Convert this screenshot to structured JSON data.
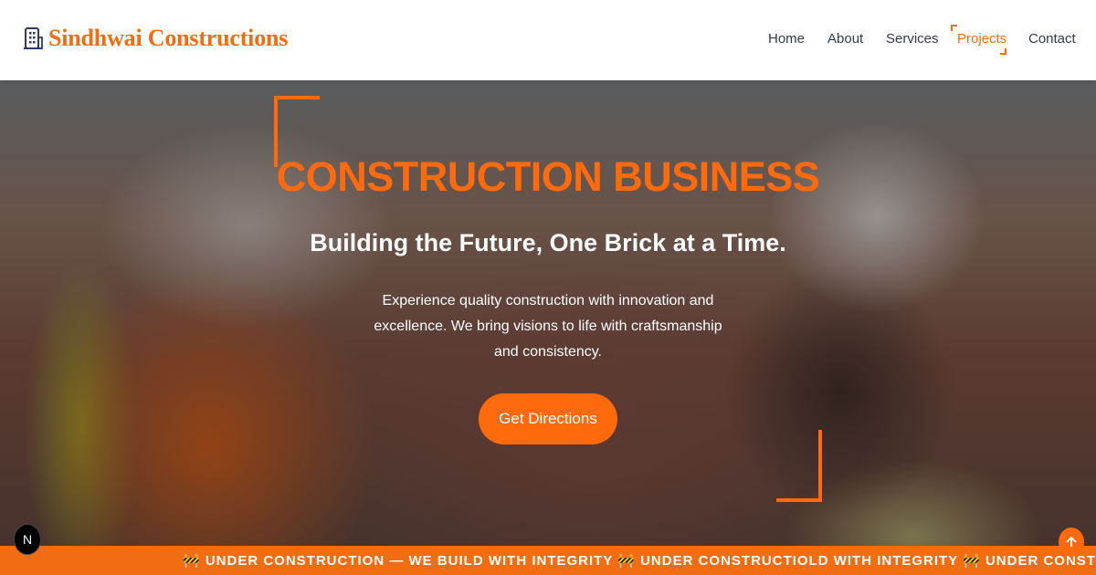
{
  "brand": {
    "name": "Sindhwai Constructions",
    "icon": "building-icon",
    "color": "#f26d12"
  },
  "nav": {
    "items": [
      {
        "label": "Home"
      },
      {
        "label": "About"
      },
      {
        "label": "Services"
      },
      {
        "label": "Projects",
        "active": true
      },
      {
        "label": "Contact"
      }
    ]
  },
  "hero": {
    "title": "CONSTRUCTION BUSINESS",
    "subtitle": "Building the Future, One Brick at a Time.",
    "text": "Experience quality construction with innovation and excellence. We bring visions to life with craftsmanship and consistency.",
    "cta_label": "Get Directions",
    "accent": "#ff6a0d"
  },
  "ticker": {
    "text": "🚧 UNDER CONSTRUCTION — WE BUILD WITH INTEGRITY 🚧 UNDER CONSTRUCTIOLD WITH INTEGRITY 🚧 UNDER CONSTRUCTION — WE B"
  },
  "floating": {
    "left_badge": "N",
    "scroll_top_icon": "arrow-up-icon"
  }
}
